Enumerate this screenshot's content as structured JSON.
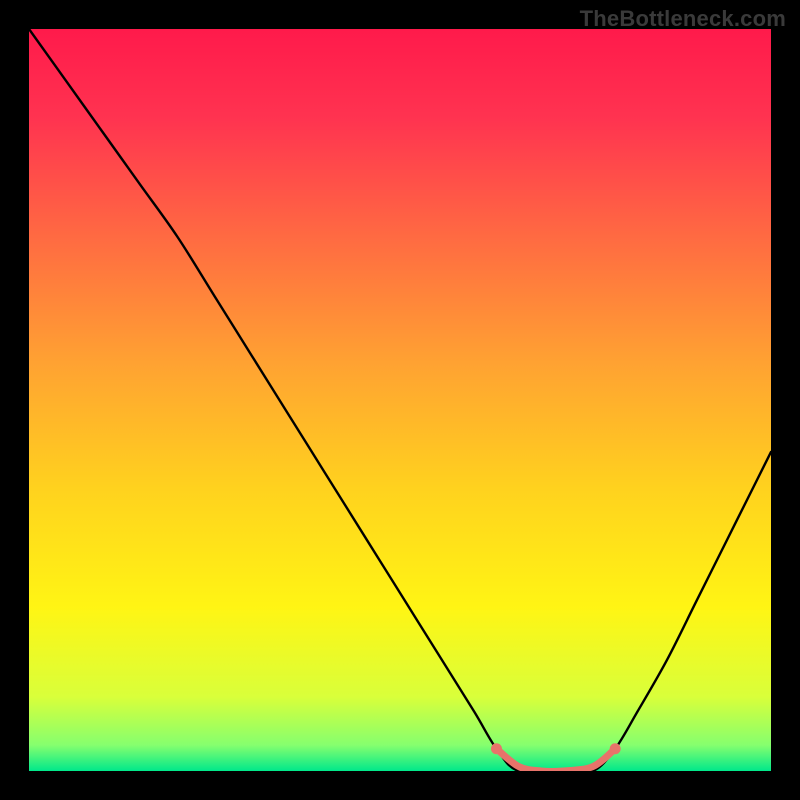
{
  "watermark": "TheBottleneck.com",
  "chart_data": {
    "type": "line",
    "title": "",
    "xlabel": "",
    "ylabel": "",
    "xlim": [
      0,
      100
    ],
    "ylim": [
      0,
      100
    ],
    "background_gradient": {
      "stops": [
        {
          "offset": 0.0,
          "color": "#ff1a4b"
        },
        {
          "offset": 0.12,
          "color": "#ff3350"
        },
        {
          "offset": 0.28,
          "color": "#ff6a42"
        },
        {
          "offset": 0.45,
          "color": "#ffa232"
        },
        {
          "offset": 0.62,
          "color": "#ffd21e"
        },
        {
          "offset": 0.78,
          "color": "#fff514"
        },
        {
          "offset": 0.9,
          "color": "#d9ff3a"
        },
        {
          "offset": 0.965,
          "color": "#86ff6e"
        },
        {
          "offset": 1.0,
          "color": "#00e88b"
        }
      ]
    },
    "series": [
      {
        "name": "bottleneck-curve",
        "color": "#000000",
        "x": [
          0,
          5,
          10,
          15,
          20,
          25,
          30,
          35,
          40,
          45,
          50,
          55,
          60,
          63,
          66,
          72,
          76,
          79,
          82,
          86,
          90,
          94,
          98,
          100
        ],
        "y": [
          100,
          93,
          86,
          79,
          72,
          64,
          56,
          48,
          40,
          32,
          24,
          16,
          8,
          3,
          0,
          0,
          0,
          3,
          8,
          15,
          23,
          31,
          39,
          43
        ]
      }
    ],
    "highlight_segment": {
      "name": "sweet-spot",
      "color": "#e8736a",
      "x": [
        63,
        66,
        69,
        72,
        76,
        79
      ],
      "y": [
        3,
        0.6,
        0,
        0,
        0.6,
        3
      ],
      "end_dots": [
        {
          "x": 63,
          "y": 3
        },
        {
          "x": 79,
          "y": 3
        }
      ]
    }
  }
}
